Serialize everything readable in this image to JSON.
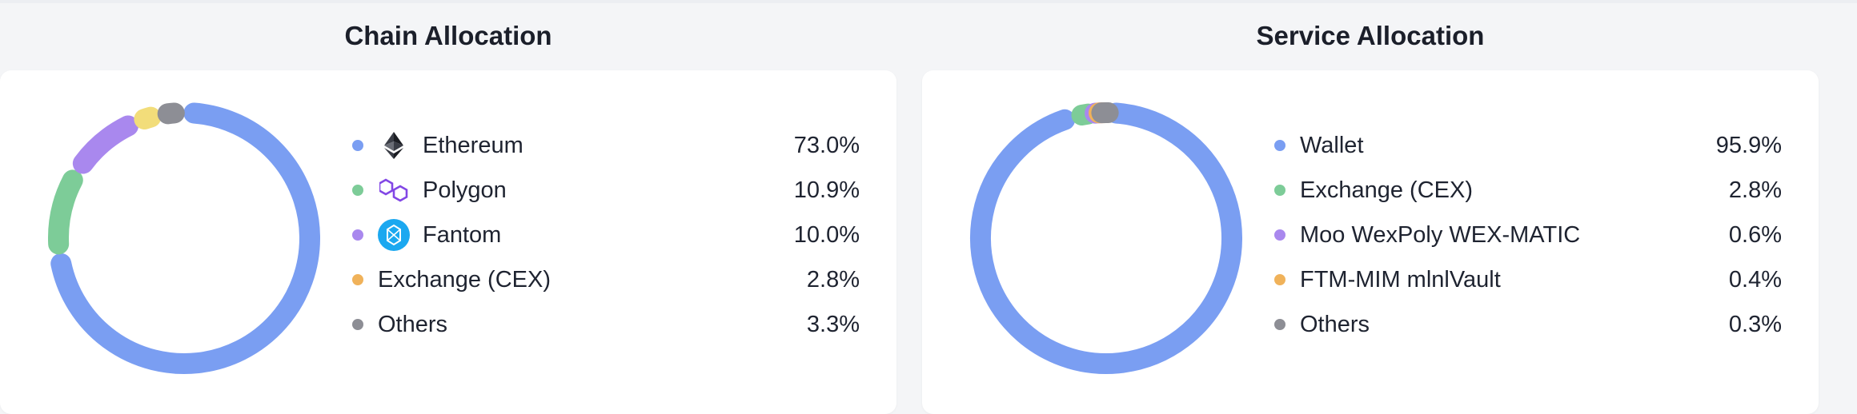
{
  "chain_section": {
    "title": "Chain Allocation",
    "legend": [
      {
        "label": "Ethereum",
        "value": "73.0%",
        "color": "#7a9ef2",
        "icon": "ethereum-icon"
      },
      {
        "label": "Polygon",
        "value": "10.9%",
        "color": "#7dcc98",
        "icon": "polygon-icon"
      },
      {
        "label": "Fantom",
        "value": "10.0%",
        "color": "#a988ee",
        "icon": "fantom-icon"
      },
      {
        "label": "Exchange (CEX)",
        "value": "2.8%",
        "color": "#f0b25a",
        "icon": null
      },
      {
        "label": "Others",
        "value": "3.3%",
        "color": "#8d8e95",
        "icon": null
      }
    ]
  },
  "service_section": {
    "title": "Service Allocation",
    "legend": [
      {
        "label": "Wallet",
        "value": "95.9%",
        "color": "#7a9ef2"
      },
      {
        "label": "Exchange (CEX)",
        "value": "2.8%",
        "color": "#7dcc98"
      },
      {
        "label": "Moo WexPoly WEX-MATIC",
        "value": "0.6%",
        "color": "#a988ee"
      },
      {
        "label": "FTM-MIM mlnlVault",
        "value": "0.4%",
        "color": "#f0b25a"
      },
      {
        "label": "Others",
        "value": "0.3%",
        "color": "#8d8e95"
      }
    ]
  },
  "chart_data": [
    {
      "type": "pie",
      "title": "Chain Allocation",
      "categories": [
        "Ethereum",
        "Polygon",
        "Fantom",
        "Exchange (CEX)",
        "Others"
      ],
      "values": [
        73.0,
        10.9,
        10.0,
        2.8,
        3.3
      ],
      "unit": "%",
      "colors": [
        "#7a9ef2",
        "#7dcc98",
        "#a988ee",
        "#f2dd7a",
        "#8d8e95"
      ],
      "style": "donut",
      "legend": "right"
    },
    {
      "type": "pie",
      "title": "Service Allocation",
      "categories": [
        "Wallet",
        "Exchange (CEX)",
        "Moo WexPoly WEX-MATIC",
        "FTM-MIM mlnlVault",
        "Others"
      ],
      "values": [
        95.9,
        2.8,
        0.6,
        0.4,
        0.3
      ],
      "unit": "%",
      "colors": [
        "#7a9ef2",
        "#7dcc98",
        "#a988ee",
        "#f0b25a",
        "#8d8e95"
      ],
      "style": "donut",
      "legend": "right"
    }
  ]
}
